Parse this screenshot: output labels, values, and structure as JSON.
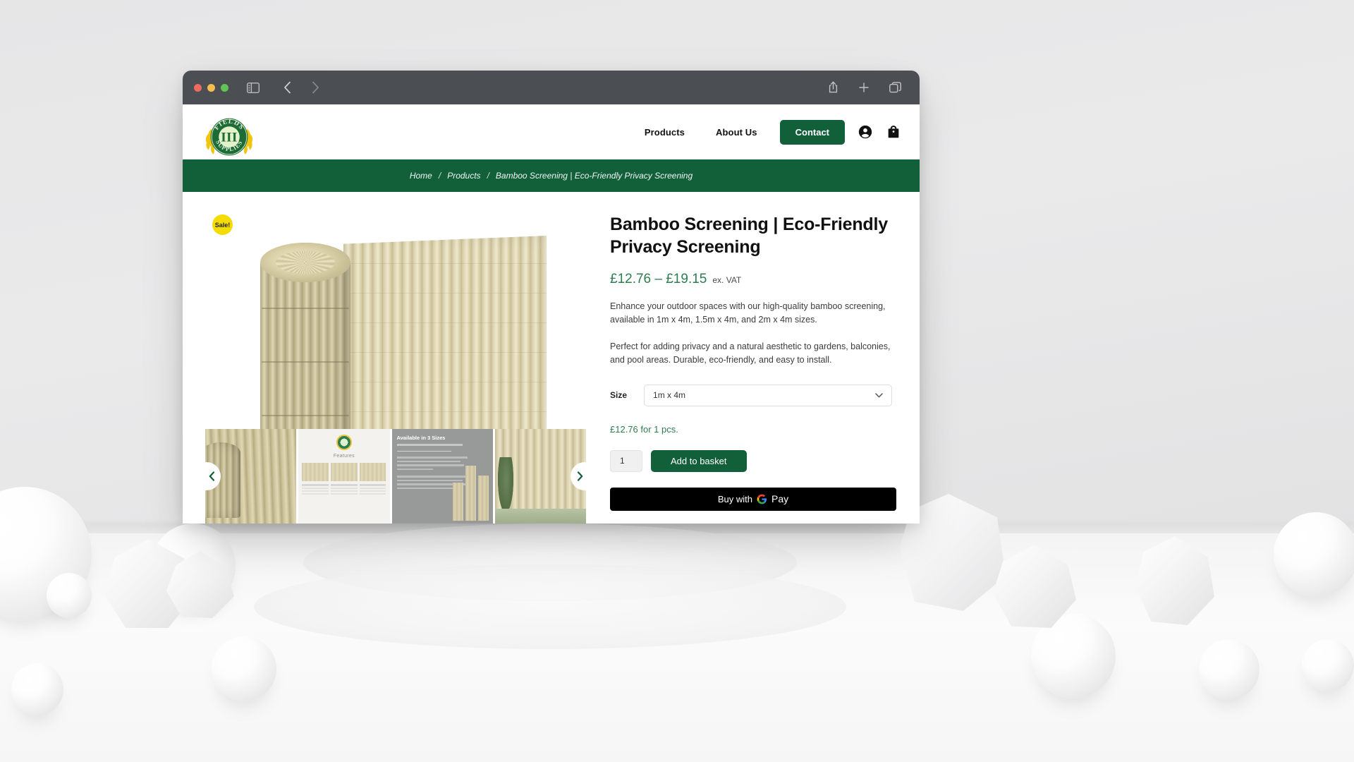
{
  "browser": {
    "traffic_lights": [
      "close",
      "minimize",
      "maximize"
    ],
    "sidebar_icon": "sidebar-icon",
    "back_icon": "chevron-left-icon",
    "forward_icon": "chevron-right-icon",
    "share_icon": "share-icon",
    "new_tab_icon": "plus-icon",
    "tabs_icon": "tabs-overview-icon"
  },
  "header": {
    "logo": {
      "top_text": "FIELDS",
      "center_text": "III",
      "bottom_text": "SUPPLIES"
    },
    "nav": [
      {
        "label": "Products"
      },
      {
        "label": "About Us"
      }
    ],
    "contact_label": "Contact",
    "account_icon": "account-circle-icon",
    "basket_icon": "shopping-bag-icon"
  },
  "breadcrumb": {
    "items": [
      "Home",
      "Products",
      "Bamboo Screening | Eco-Friendly Privacy Screening"
    ],
    "separator": "/"
  },
  "gallery": {
    "sale_badge": "Sale!",
    "prev_arrow_icon": "chevron-left-icon",
    "next_arrow_icon": "chevron-right-icon",
    "thumbnails": [
      {
        "name": "bamboo-roll-closeup"
      },
      {
        "name": "features-infographic",
        "title": "Features"
      },
      {
        "name": "available-in-3-sizes",
        "title": "Available in 3 Sizes"
      },
      {
        "name": "bamboo-fence-installed"
      }
    ]
  },
  "product": {
    "title": "Bamboo Screening | Eco-Friendly Privacy Screening",
    "price_range": "£12.76 – £19.15",
    "price_vat_note": "ex. VAT",
    "description_1": "Enhance your outdoor spaces with our high-quality bamboo screening, available in 1m x 4m, 1.5m x 4m, and 2m x 4m sizes.",
    "description_2": "Perfect for adding privacy and a natural aesthetic to gardens, balconies, and pool areas. Durable, eco-friendly, and easy to install.",
    "size_label": "Size",
    "size_selected": "1m x 4m",
    "size_options": [
      "1m x 4m",
      "1.5m x 4m",
      "2m x 4m"
    ],
    "unit_price_note": "£12.76 for 1 pcs.",
    "quantity": "1",
    "add_to_basket_label": "Add to basket",
    "gpay_prefix": "Buy with",
    "gpay_label": "Pay"
  },
  "colors": {
    "brand_green": "#11603a",
    "price_green": "#2e7d4f",
    "sale_yellow": "#f5dc00",
    "chrome_gray": "#4b4e53",
    "gpay_black": "#000000"
  }
}
